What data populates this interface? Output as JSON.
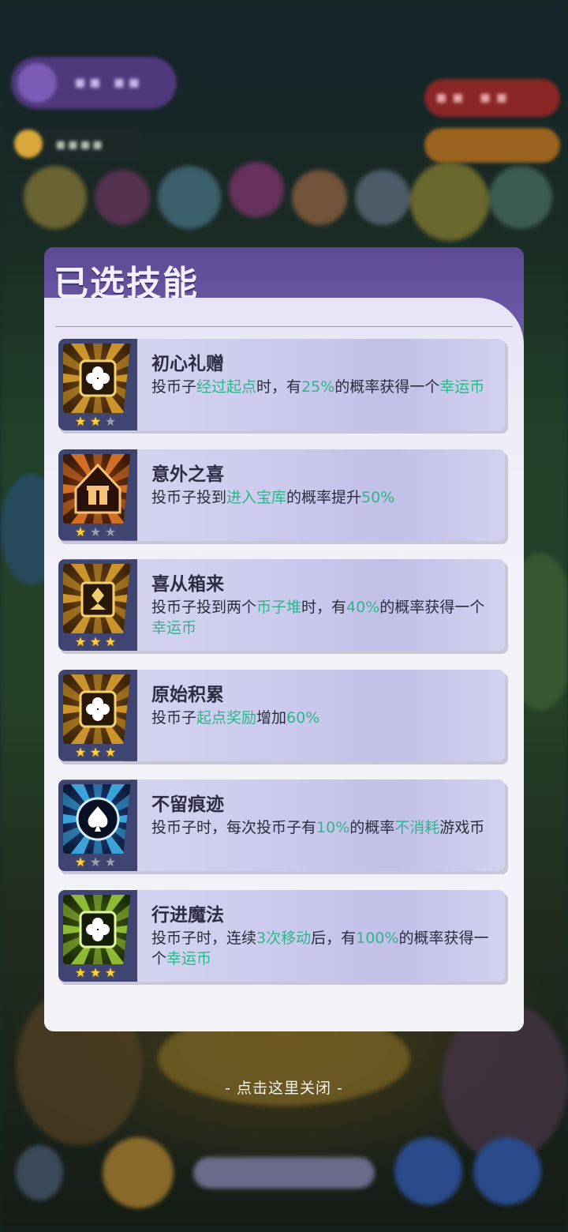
{
  "panel": {
    "title": "已选技能"
  },
  "skills": [
    {
      "name": "初心礼赠",
      "stars": 2,
      "icon": "clover-burst-icon",
      "tone": "gold",
      "desc": [
        {
          "t": "投币子"
        },
        {
          "t": "经过起点",
          "hl": true
        },
        {
          "t": "时，有"
        },
        {
          "t": "25%",
          "hl": true
        },
        {
          "t": "的概率获得一个"
        },
        {
          "t": "幸运币",
          "hl": true
        }
      ]
    },
    {
      "name": "意外之喜",
      "stars": 1,
      "icon": "gift-house-icon",
      "tone": "orange",
      "desc": [
        {
          "t": "投币子投到"
        },
        {
          "t": "进入宝库",
          "hl": true
        },
        {
          "t": "的概率提升"
        },
        {
          "t": "50%",
          "hl": true
        }
      ]
    },
    {
      "name": "喜从箱来",
      "stars": 3,
      "icon": "diamond-box-icon",
      "tone": "gold",
      "desc": [
        {
          "t": "投币子投到两个"
        },
        {
          "t": "币子堆",
          "hl": true
        },
        {
          "t": "时，有"
        },
        {
          "t": "40%",
          "hl": true
        },
        {
          "t": "的概率获得一个"
        },
        {
          "t": "幸运币",
          "hl": true
        }
      ]
    },
    {
      "name": "原始积累",
      "stars": 3,
      "icon": "clover-box-icon",
      "tone": "gold",
      "desc": [
        {
          "t": "投币子"
        },
        {
          "t": "起点奖励",
          "hl": true
        },
        {
          "t": "增加"
        },
        {
          "t": "60%",
          "hl": true
        }
      ]
    },
    {
      "name": "不留痕迹",
      "stars": 1,
      "icon": "spade-icon",
      "tone": "blue",
      "desc": [
        {
          "t": "投币子时，每次投币子有"
        },
        {
          "t": "10%",
          "hl": true
        },
        {
          "t": "的概率"
        },
        {
          "t": "不消耗",
          "hl": true
        },
        {
          "t": "游戏币"
        }
      ]
    },
    {
      "name": "行进魔法",
      "stars": 3,
      "icon": "clover-green-box-icon",
      "tone": "green",
      "desc": [
        {
          "t": "投币子时，连续"
        },
        {
          "t": "3次移动",
          "hl": true
        },
        {
          "t": "后，有"
        },
        {
          "t": "100%",
          "hl": true
        },
        {
          "t": "的概率获得一个"
        },
        {
          "t": "幸运币",
          "hl": true
        }
      ]
    }
  ],
  "close_hint": "- 点击这里关闭 -",
  "colors": {
    "highlight": "#2db58c",
    "panel_header": "#5c4a94",
    "star_on": "#ffd23a"
  }
}
